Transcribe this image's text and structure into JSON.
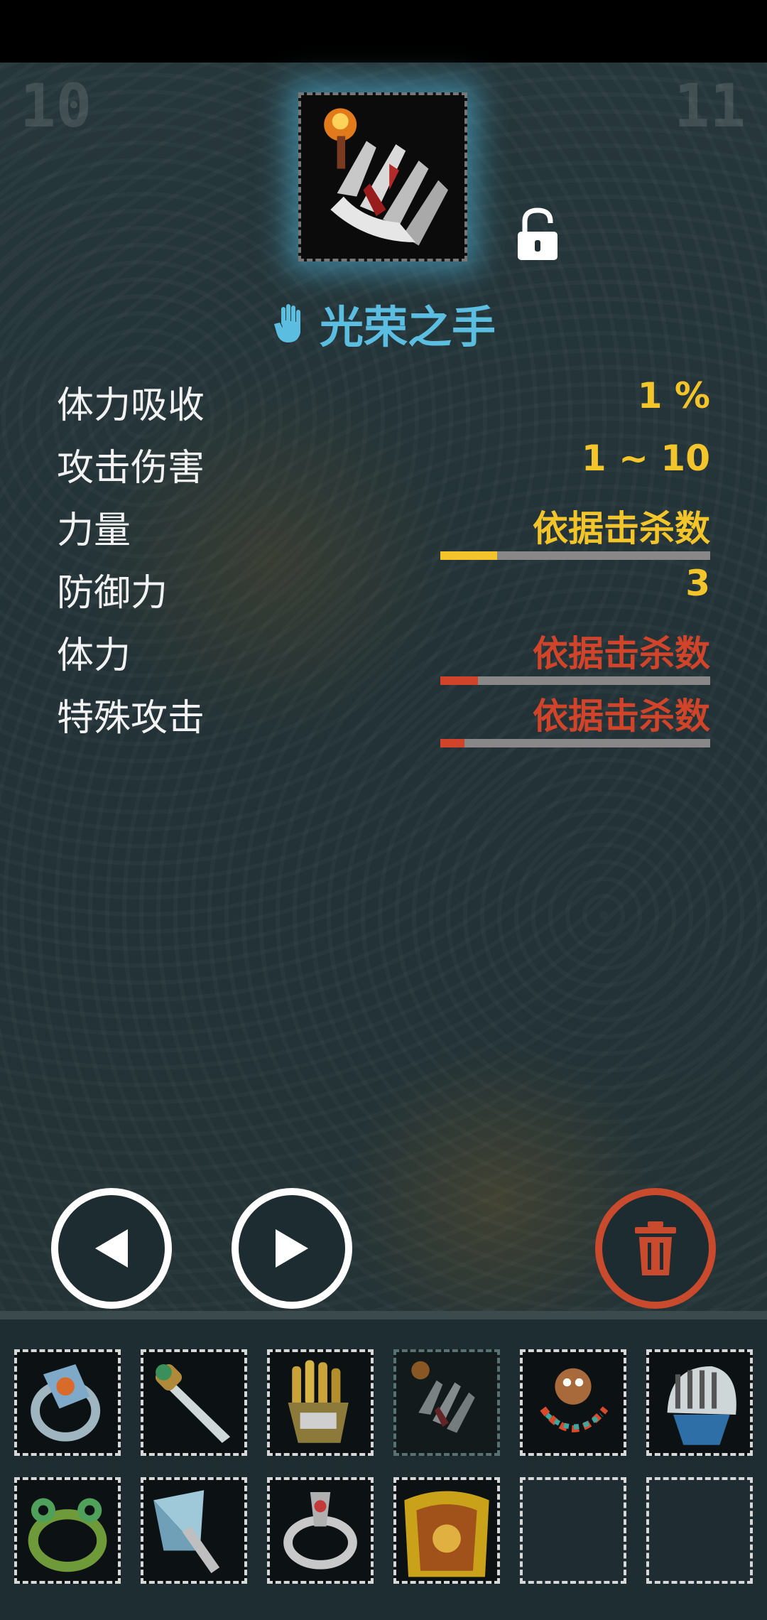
{
  "corners": {
    "left": "10",
    "right": "11"
  },
  "item": {
    "name": "光荣之手",
    "icon": "hand-of-glory-icon",
    "locked": false
  },
  "stats": [
    {
      "label": "体力吸收",
      "value": "1 %",
      "color": "#f3c52a"
    },
    {
      "label": "攻击伤害",
      "value": "1 ~ 10",
      "color": "#f3c52a"
    },
    {
      "label": "力量",
      "value": "依据击杀数",
      "color": "#f3c52a",
      "progress": 0.21,
      "bar_color": "#f3c52a"
    },
    {
      "label": "防御力",
      "value": "3",
      "color": "#f3c52a"
    },
    {
      "label": "体力",
      "value": "依据击杀数",
      "color": "#d2442a",
      "progress": 0.14,
      "bar_color": "#d2442a"
    },
    {
      "label": "特殊攻击",
      "value": "依据击杀数",
      "color": "#d2442a",
      "progress": 0.09,
      "bar_color": "#d2442a"
    }
  ],
  "controls": {
    "prev": "previous-arrow-icon",
    "next": "next-arrow-icon",
    "delete": "trash-icon"
  },
  "inventory": [
    {
      "icon": "ring-icon"
    },
    {
      "icon": "dagger-icon"
    },
    {
      "icon": "golden-gauntlet-icon"
    },
    {
      "icon": "hand-of-glory-icon",
      "selected": true
    },
    {
      "icon": "bead-necklace-icon"
    },
    {
      "icon": "helmet-icon"
    },
    {
      "icon": "jade-ring-icon"
    },
    {
      "icon": "fan-axe-icon"
    },
    {
      "icon": "silver-ring-icon"
    },
    {
      "icon": "golden-armor-icon"
    },
    {
      "icon": "empty-slot"
    },
    {
      "icon": "empty-slot"
    }
  ]
}
